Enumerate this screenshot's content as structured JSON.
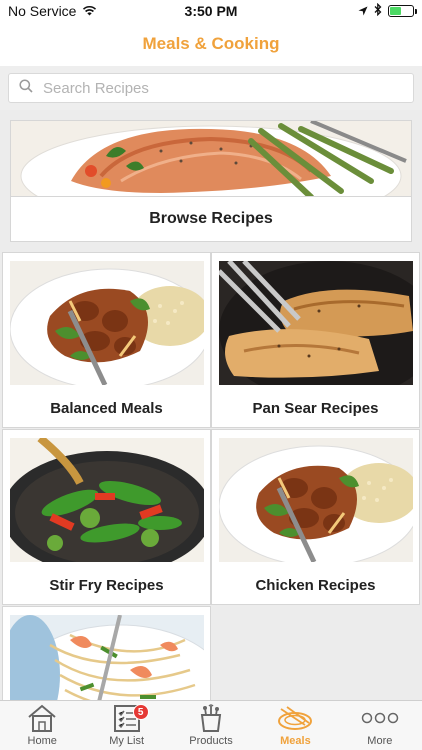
{
  "status": {
    "carrier": "No Service",
    "time": "3:50 PM",
    "battery_level": 0.5
  },
  "nav": {
    "title": "Meals & Cooking"
  },
  "search": {
    "placeholder": "Search Recipes"
  },
  "browse": {
    "label": "Browse Recipes"
  },
  "tiles": [
    {
      "label": "Balanced Meals",
      "image": "chicken-stirfry-rice-plate"
    },
    {
      "label": "Pan Sear Recipes",
      "image": "seared-fish-in-pan"
    },
    {
      "label": "Stir Fry Recipes",
      "image": "vegetable-stirfry-wok"
    },
    {
      "label": "Chicken Recipes",
      "image": "chicken-stirfry-rice-plate"
    },
    {
      "label": "",
      "image": "shrimp-noodles-plate"
    }
  ],
  "tabbar": {
    "items": [
      {
        "label": "Home",
        "icon": "home-icon"
      },
      {
        "label": "My List",
        "icon": "list-icon",
        "badge": "5"
      },
      {
        "label": "Products",
        "icon": "grocery-bag-icon"
      },
      {
        "label": "Meals",
        "icon": "meals-icon",
        "active": true
      },
      {
        "label": "More",
        "icon": "more-icon"
      }
    ]
  },
  "colors": {
    "accent": "#f0a23c",
    "badge": "#e53935"
  }
}
